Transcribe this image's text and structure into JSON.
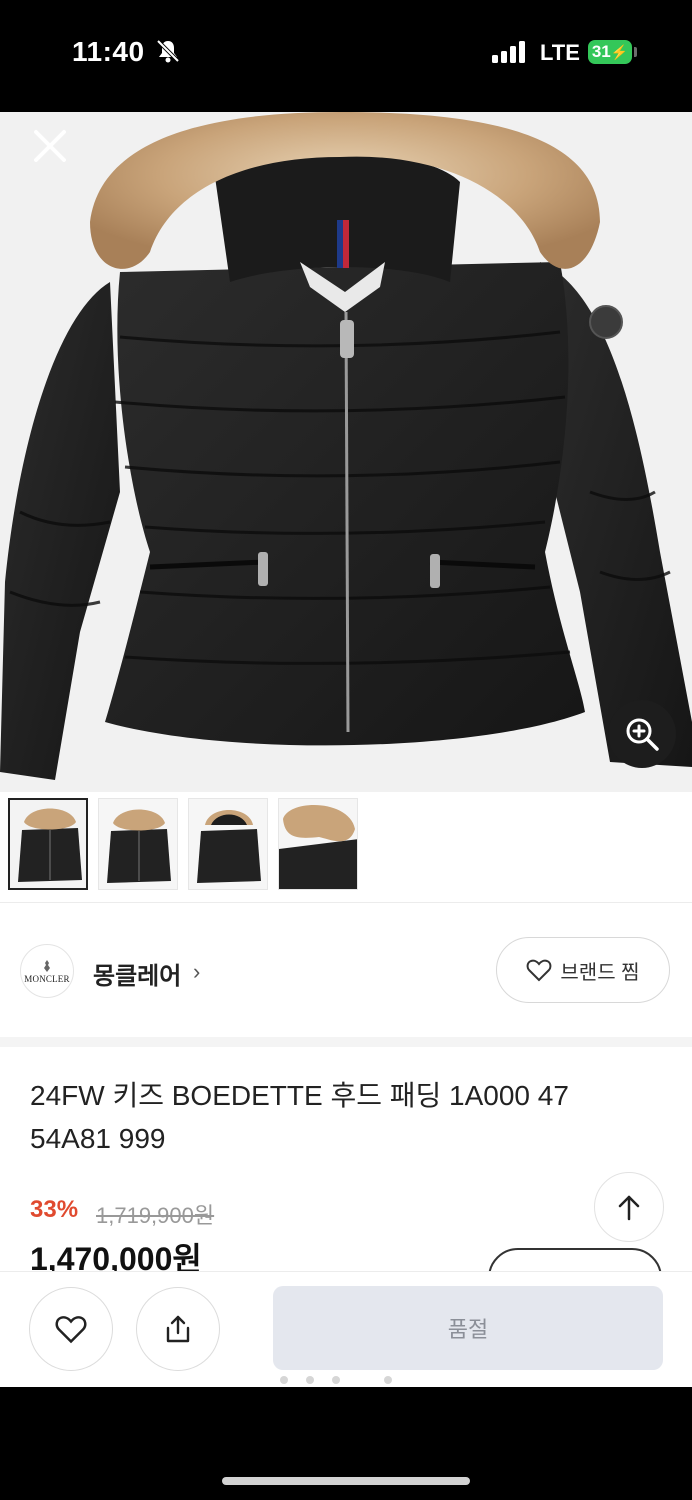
{
  "status_bar": {
    "time": "11:40",
    "network": "LTE",
    "battery": "31"
  },
  "hero": {
    "close_icon": "close-icon",
    "zoom_icon": "zoom-in-icon",
    "thumbnail_count": 4,
    "active_thumbnail": 1
  },
  "brand": {
    "logo_text": "MONCLER",
    "name": "몽클레어",
    "favorite_label": "브랜드 찜"
  },
  "product": {
    "title": "24FW 키즈 BOEDETTE 후드 패딩 1A000 47 54A81 999",
    "discount": "33%",
    "original_price": "1,719,900원",
    "price": "1,470,000원"
  },
  "bottom_bar": {
    "like_icon": "heart-icon",
    "share_icon": "share-icon",
    "soldout_label": "품절"
  },
  "colors": {
    "discount": "#e04a2f",
    "soldout_bg": "#e4e7ee",
    "battery": "#34c759"
  }
}
